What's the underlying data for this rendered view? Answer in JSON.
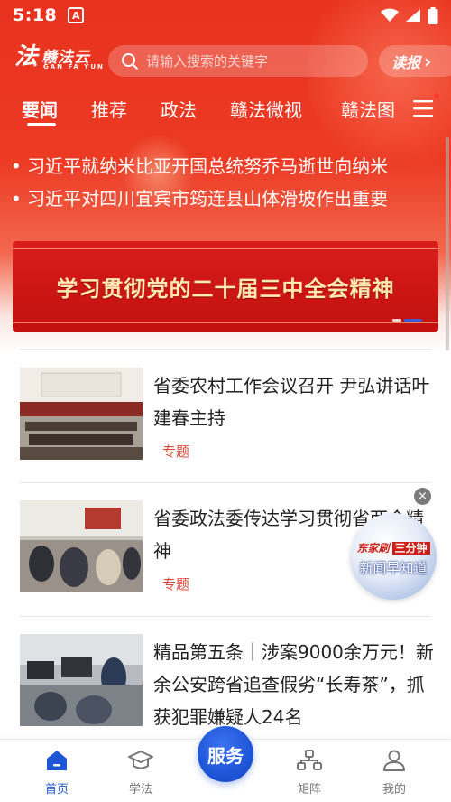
{
  "status_bar": {
    "time": "5:18",
    "app_badge": "A"
  },
  "header": {
    "logo_mark": "法",
    "logo_name": "赣法云",
    "logo_pinyin": "GAN FA YUN",
    "search_placeholder": "请输入搜索的关键字",
    "read_label": "读报",
    "read_chevron": "›"
  },
  "tabs": [
    {
      "label": "要闻",
      "active": true
    },
    {
      "label": "推荐",
      "active": false
    },
    {
      "label": "政法",
      "active": false
    },
    {
      "label": "赣法微视",
      "active": false
    },
    {
      "label": "赣法图",
      "active": false
    }
  ],
  "ticker": [
    "• 习近平就纳米比亚开国总统努乔马逝世向纳米",
    "• 习近平对四川宜宾市筠连县山体滑坡作出重要"
  ],
  "banner": {
    "text": "学习贯彻党的二十届三中全会精神"
  },
  "news": [
    {
      "title": "省委农村工作会议召开 尹弘讲话叶建春主持",
      "tag": "专题"
    },
    {
      "title": "省委政法委传达学习贯彻省两会精神",
      "tag": "专题"
    },
    {
      "title": "精品第五条｜涉案9000余万元！新余公安跨省追查假劣“长寿茶”，抓获犯罪嫌疑人24名",
      "tag": ""
    }
  ],
  "float_card": {
    "line1_a": "东家刷",
    "line1_b": "三分钟",
    "line2": "新闻早知道",
    "close": "×"
  },
  "bottom_nav": {
    "items": [
      {
        "label": "首页",
        "icon": "home-icon",
        "active": true
      },
      {
        "label": "学法",
        "icon": "graduation-cap-icon",
        "active": false
      },
      {
        "label": "矩阵",
        "icon": "network-icon",
        "active": false
      },
      {
        "label": "我的",
        "icon": "user-icon",
        "active": false
      }
    ],
    "center_label": "服务"
  },
  "colors": {
    "brand_red": "#e8321f",
    "accent_blue": "#1e56d6",
    "tag_red": "#e0463a"
  }
}
